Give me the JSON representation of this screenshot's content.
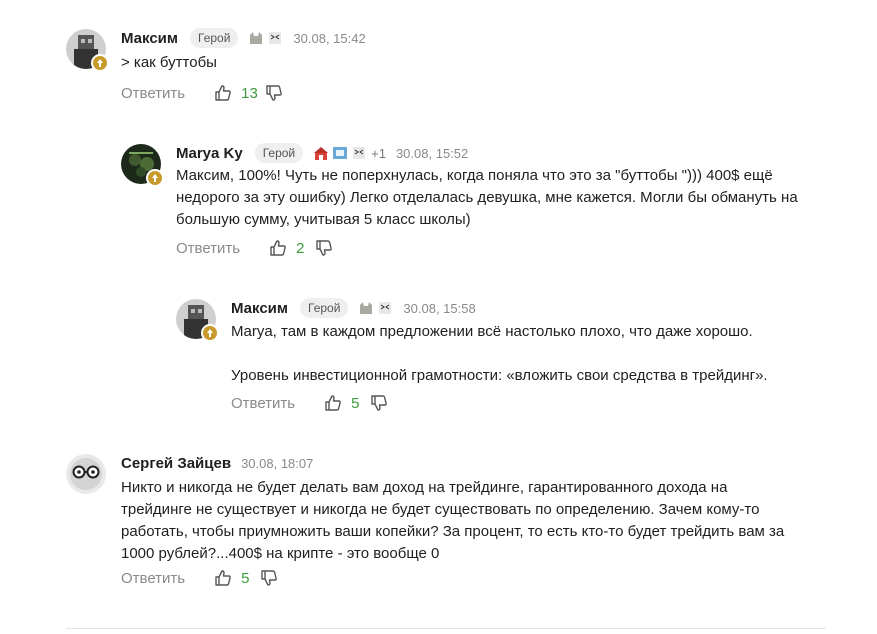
{
  "comments": [
    {
      "author": "Максим",
      "role": "Герой",
      "time": "30.08, 15:42",
      "text": "> как буттобы",
      "reply_label": "Ответить",
      "likes": "13",
      "stickers": [
        "cat-sticker",
        "cat-face-sticker"
      ]
    },
    {
      "author": "Marya Ky",
      "role": "Герой",
      "time": "30.08, 15:52",
      "extra_stickers": "+1",
      "text": "Максим, 100%! Чуть не поперхнулась, когда поняла что это за \"буттобы \"))) 400$ ещё\nнедорого за эту ошибку) Легко отделалась девушка, мне кажется. Могли бы обмануть на\nбольшую сумму, учитывая 5 класс школы)",
      "reply_label": "Ответить",
      "likes": "2",
      "stickers": [
        "red-house-sticker",
        "blue-picture-sticker",
        "cat-face-sticker"
      ]
    },
    {
      "author": "Максим",
      "role": "Герой",
      "time": "30.08, 15:58",
      "text": "Marya, там в каждом предложении всё настолько плохо, что даже хорошо.\n\nУровень инвестиционной грамотности: «вложить свои средства в трейдинг».",
      "reply_label": "Ответить",
      "likes": "5",
      "stickers": [
        "cat-sticker",
        "cat-face-sticker"
      ]
    },
    {
      "author": "Сергей Зайцев",
      "time": "30.08, 18:07",
      "text": "Никто и никогда не будет делать вам доход на трейдинге, гарантированного дохода на\nтрейдинге не существует и никогда не будет существовать по определению. Зачем кому-то\nработать, чтобы приумножить ваши копейки? За процент, то есть кто-то будет трейдить вам за\n1000 рублей?...400$ на крипте - это вообще 0",
      "reply_label": "Ответить",
      "likes": "5"
    }
  ],
  "colors": {
    "like_count": "#3d9a3d",
    "muted": "#8a8a8a",
    "badge": "#c79a2b"
  }
}
